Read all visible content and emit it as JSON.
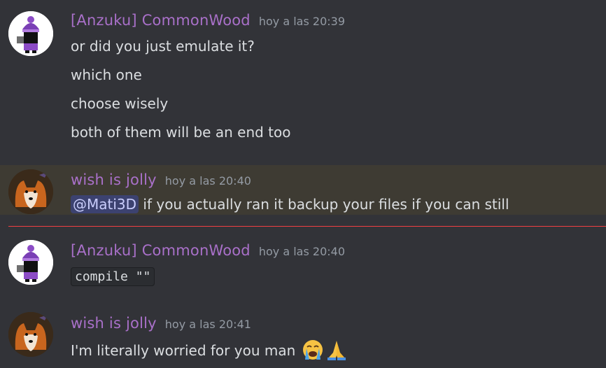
{
  "messages": [
    {
      "author": "[Anzuku] CommonWood",
      "timestamp": "hoy a las 20:39",
      "avatar_icon": "hooded-character-avatar",
      "lines": [
        "or did you just emulate it?",
        "which one",
        "choose wisely",
        "both of them will be an end too"
      ]
    },
    {
      "author": "wish is jolly",
      "timestamp": "hoy a las 20:40",
      "avatar_icon": "fox-avatar",
      "mention": "@Mati3D",
      "text": " if you actually ran it backup your files if you can still"
    },
    {
      "author": "[Anzuku] CommonWood",
      "timestamp": "hoy a las 20:40",
      "avatar_icon": "hooded-character-avatar",
      "code": "compile \"\""
    },
    {
      "author": "wish is jolly",
      "timestamp": "hoy a las 20:41",
      "avatar_icon": "fox-avatar",
      "text": "I'm literally worried for you man",
      "emojis": [
        "crying-face-emoji",
        "folded-hands-emoji"
      ]
    }
  ],
  "colors": {
    "background": "#323338",
    "author": "#a970c9",
    "timestamp": "#949ba4",
    "mention_bg": "#3c4270",
    "highlight": "#3e3b33",
    "new_divider": "#f23f43"
  }
}
